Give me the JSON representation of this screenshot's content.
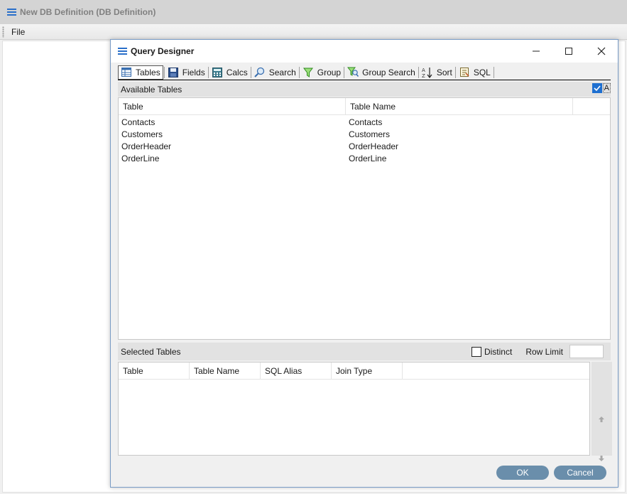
{
  "outer_window": {
    "title": "New DB Definition (DB Definition)",
    "menu": [
      "File"
    ]
  },
  "dialog": {
    "title": "Query Designer",
    "toolbar": [
      {
        "label": "Tables",
        "icon": "table-icon",
        "active": true
      },
      {
        "label": "Fields",
        "icon": "floppy-disk-icon"
      },
      {
        "label": "Calcs",
        "icon": "calculator-icon"
      },
      {
        "label": "Search",
        "icon": "magnifier-icon"
      },
      {
        "label": "Group",
        "icon": "funnel-icon"
      },
      {
        "label": "Group Search",
        "icon": "funnel-search-icon"
      },
      {
        "label": "Sort",
        "icon": "sort-az-icon"
      },
      {
        "label": "SQL",
        "icon": "sql-script-icon"
      }
    ],
    "available_tables": {
      "label": "Available Tables",
      "check_label": "A",
      "columns": [
        "Table",
        "Table Name"
      ],
      "rows": [
        [
          "Contacts",
          "Contacts"
        ],
        [
          "Customers",
          "Customers"
        ],
        [
          "OrderHeader",
          "OrderHeader"
        ],
        [
          "OrderLine",
          "OrderLine"
        ]
      ]
    },
    "selected_tables": {
      "label": "Selected Tables",
      "distinct_label": "Distinct",
      "row_limit_label": "Row Limit",
      "row_limit_value": "",
      "columns": [
        "Table",
        "Table Name",
        "SQL Alias",
        "Join Type"
      ]
    },
    "buttons": {
      "ok": "OK",
      "cancel": "Cancel"
    }
  },
  "colors": {
    "accent": "#2a6fc9",
    "button": "#6a8eab",
    "checked": "#1e6fd0"
  }
}
